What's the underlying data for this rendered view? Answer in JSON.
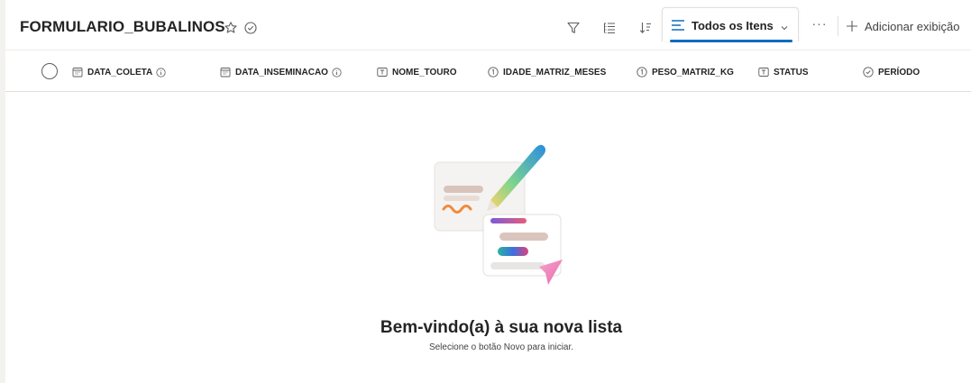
{
  "header": {
    "title": "FORMULARIO_BUBALINOS",
    "favorite_icon": "star-icon",
    "status_icon": "check-circle-icon",
    "filter_icon": "filter-icon",
    "grouping_icon": "list-grouping-icon",
    "sort_icon": "sort-icon",
    "view_tab": {
      "label": "Todos os Itens",
      "icon": "view-list-icon",
      "accent": "#0f6cbd"
    },
    "more_label": "···",
    "add_view_label": "Adicionar exibição"
  },
  "columns": [
    {
      "label": "DATA_COLETA",
      "icon": "calendar-icon",
      "info": true
    },
    {
      "label": "DATA_INSEMINACAO",
      "icon": "calendar-icon",
      "info": true
    },
    {
      "label": "NOME_TOURO",
      "icon": "text-field-icon",
      "info": false
    },
    {
      "label": "IDADE_MATRIZ_MESES",
      "icon": "number-icon",
      "info": false
    },
    {
      "label": "PESO_MATRIZ_KG",
      "icon": "number-icon",
      "info": false
    },
    {
      "label": "STATUS",
      "icon": "text-field-icon",
      "info": false
    },
    {
      "label": "PERÍODO",
      "icon": "choice-check-icon",
      "info": false
    }
  ],
  "empty_state": {
    "heading": "Bem-vindo(a) à sua nova lista",
    "subtext": "Selecione o botão Novo para iniciar."
  }
}
